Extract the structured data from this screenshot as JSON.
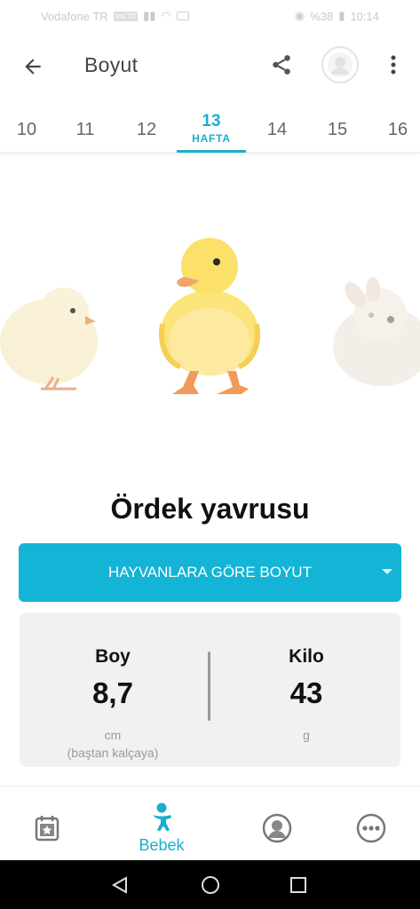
{
  "status_bar": {
    "carrier": "Vodafone TR",
    "badge": "VoLTE",
    "battery": "%38",
    "time": "10:14"
  },
  "app_bar": {
    "title": "Boyut",
    "icons": [
      "arrow-back-icon",
      "share-icon",
      "profile-avatar-icon",
      "more-vertical-icon"
    ]
  },
  "weeks": {
    "items": [
      {
        "num": "10",
        "active": false
      },
      {
        "num": "11",
        "active": false
      },
      {
        "num": "12",
        "active": false
      },
      {
        "num": "13",
        "active": true,
        "sub": "HAFTA"
      },
      {
        "num": "14",
        "active": false
      },
      {
        "num": "15",
        "active": false
      },
      {
        "num": "16",
        "active": false
      }
    ]
  },
  "animal": {
    "name": "Ördek yavrusu"
  },
  "size_selector": {
    "label": "HAYVANLARA GÖRE BOYUT"
  },
  "stats": {
    "length": {
      "label": "Boy",
      "value": "8,7",
      "unit": "cm",
      "note": "(baştan kalçaya)"
    },
    "weight": {
      "label": "Kilo",
      "value": "43",
      "unit": "g"
    }
  },
  "bottom_nav": {
    "items": [
      {
        "label": "",
        "icon": "calendar-star-icon",
        "active": false
      },
      {
        "label": "Bebek",
        "icon": "baby-icon",
        "active": true
      },
      {
        "label": "",
        "icon": "mother-profile-icon",
        "active": false
      },
      {
        "label": "",
        "icon": "more-horizontal-icon",
        "active": false
      }
    ]
  },
  "colors": {
    "accent": "#1aaecc",
    "dropdown_bg": "#13b4d6",
    "stats_bg": "#f1f1f1"
  }
}
